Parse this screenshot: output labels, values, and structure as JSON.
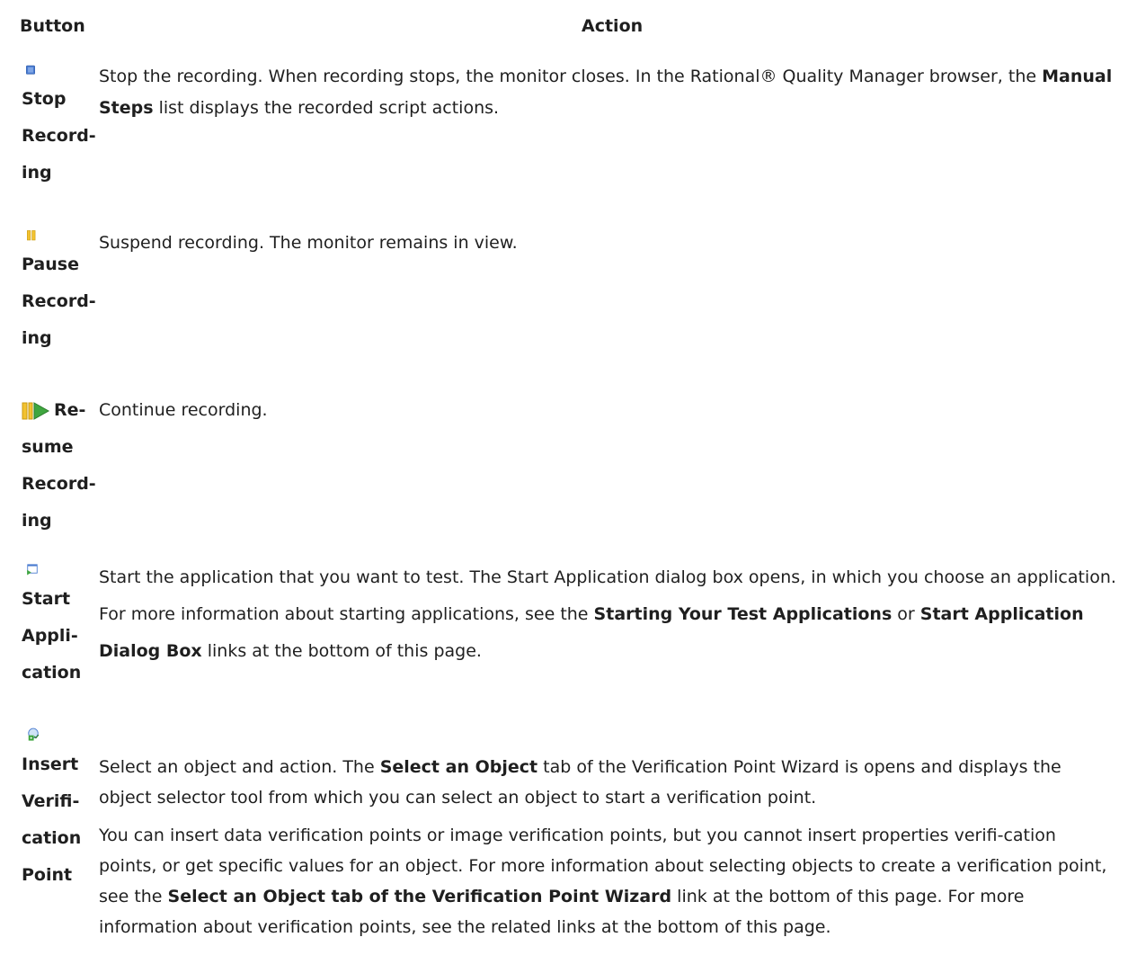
{
  "headers": {
    "button": "Button",
    "action": "Action"
  },
  "rows": [
    {
      "button_lines": [
        "Stop",
        "Record-",
        "ing"
      ],
      "icon": "stop-icon",
      "action": {
        "p1_pre": "Stop the recording. When recording stops, the monitor closes. In the  Rational® Quality Manager browser, the ",
        "p1_b1": "Manual Steps",
        "p1_post": " list displays the recorded script actions."
      }
    },
    {
      "button_lines": [
        "Pause",
        "Record-",
        "ing"
      ],
      "icon": "pause-icon",
      "action": {
        "p1": "Suspend recording. The monitor remains in view."
      }
    },
    {
      "button_lines": [
        "Re-",
        "sume",
        "Record-",
        "ing"
      ],
      "icon": "resume-icon",
      "action": {
        "p1": "Continue recording."
      }
    },
    {
      "button_lines": [
        "Start",
        "Appli-",
        "cation"
      ],
      "icon": "start-application-icon",
      "action": {
        "p1_pre": "Start the application that you want to test. The Start Application dialog box opens, in which you choose an application. For more information about starting applications, see the ",
        "p1_b1": "Starting Your Test Applications",
        "p1_mid": " or ",
        "p1_b2": "Start Application Dialog Box",
        "p1_post": " links at the bottom of this page."
      }
    },
    {
      "button_lines": [
        "Insert",
        "Verifi-",
        "cation",
        "Point"
      ],
      "icon": "insert-verification-point-icon",
      "action": {
        "p1_pre": "Select an object and action. The ",
        "p1_b1": "Select an Object",
        "p1_post": " tab of the Verification Point Wizard is opens and displays the object selector tool from which you can select an object to start a verification point.",
        "p2_pre": "You can insert data verification points or image verification points, but you cannot insert properties verifi-cation points, or get specific values for an object. For more information about selecting objects to create a verification point, see the ",
        "p2_b1": "Select an Object tab of the Verification Point Wizard",
        "p2_post": " link at the bottom of this page. For more information about verification points, see the related links at the bottom of this page."
      }
    }
  ]
}
